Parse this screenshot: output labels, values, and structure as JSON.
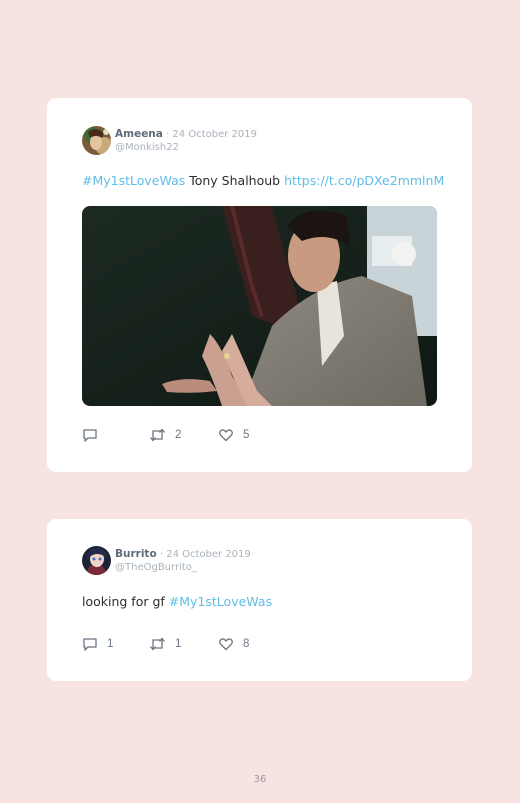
{
  "tweets": [
    {
      "author": "Ameena",
      "date": "24 October 2019",
      "handle": "@Monkish22",
      "text_hashtag": "#My1stLoveWas",
      "text_body": " Tony Shalhoub ",
      "text_link": "https://t.co/pDXe2mmlnM",
      "replies": "",
      "retweets": "2",
      "likes": "5",
      "has_media": true
    },
    {
      "author": "Burrito",
      "date": "24 October 2019",
      "handle": "@TheOgBurrito_",
      "text_body": "looking for gf ",
      "text_hashtag": "#My1stLoveWas",
      "replies": "1",
      "retweets": "1",
      "likes": "8",
      "has_media": false
    }
  ],
  "separator": " · ",
  "page_number": "36",
  "colors": {
    "background": "#f8e3e3",
    "card": "#ffffff",
    "link": "#5fbde6",
    "author": "#5d6b7a",
    "muted": "#a9b2bb"
  },
  "icons": [
    "reply-icon",
    "retweet-icon",
    "like-icon"
  ]
}
